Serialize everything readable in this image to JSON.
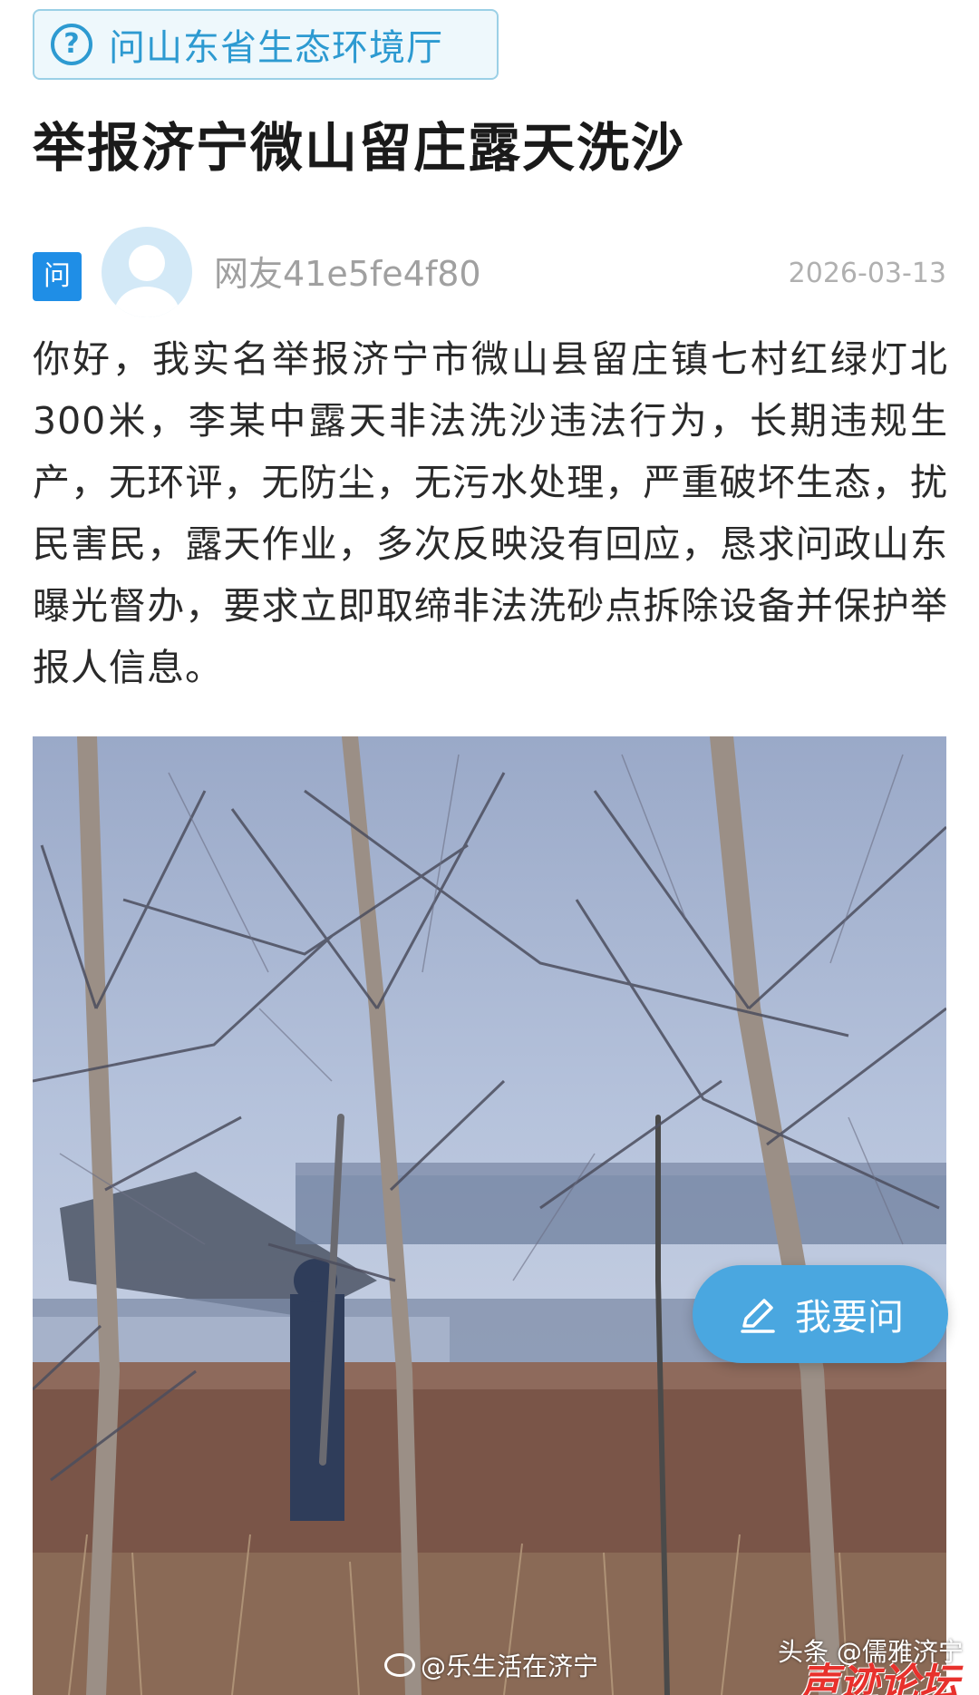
{
  "department": {
    "icon": "question-circle-icon",
    "name": "问山东省生态环境厅"
  },
  "post": {
    "title": "举报济宁微山留庄露天洗沙",
    "badge": "问",
    "avatar_icon": "user-avatar-icon",
    "username": "网友41e5fe4f80",
    "date": "2026-03-13",
    "content": "你好，我实名举报济宁市微山县留庄镇七村红绿灯北300米，李某中露天非法洗沙违法行为，长期违规生产，无环评，无防尘，无污水处理，严重破坏生态，扰民害民，露天作业，多次反映没有回应，恳求问政山东曝光督办，要求立即取缔非法洗砂点拆除设备并保护举报人信息。"
  },
  "fab": {
    "icon": "pen-edit-icon",
    "label": "我要问"
  },
  "watermarks": {
    "weibo": "@乐生活在济宁",
    "toutiao": "头条 @儒雅济宁",
    "logo": "声迹论坛"
  },
  "colors": {
    "accent": "#2d9ad1",
    "badge_blue": "#1f8ee6",
    "fab_blue": "#4aa7e0",
    "logo_red": "#e8312c"
  }
}
